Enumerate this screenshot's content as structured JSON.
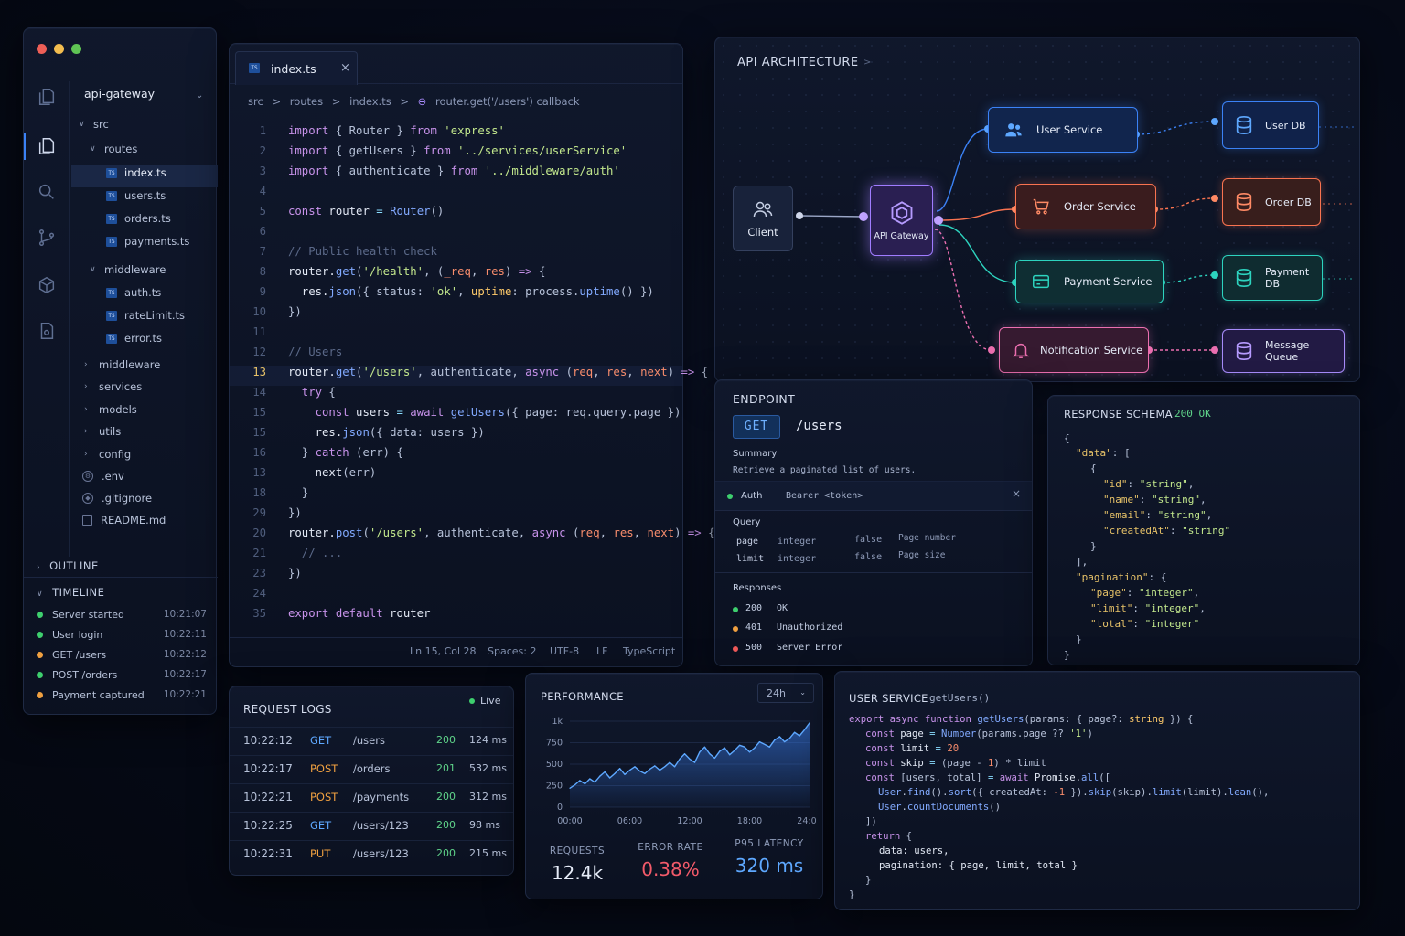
{
  "sidebar": {
    "project": "api-gateway",
    "tree": {
      "src": "src",
      "routes": "routes",
      "files_routes": [
        "index.ts",
        "users.ts",
        "orders.ts",
        "payments.ts"
      ],
      "middleware": "middleware",
      "files_middleware": [
        "auth.ts",
        "rateLimit.ts",
        "error.ts"
      ],
      "folders": [
        "middleware",
        "services",
        "models",
        "utils",
        "config"
      ],
      "env": ".env",
      "gitignore": ".gitignore",
      "readme": "README.md",
      "ts_badge": "TS"
    },
    "outline": "OUTLINE",
    "timeline": {
      "title": "TIMELINE",
      "items": [
        {
          "label": "Server started",
          "time": "10:21:07",
          "color": "#3ecf6e"
        },
        {
          "label": "User login",
          "time": "10:22:11",
          "color": "#3ecf6e"
        },
        {
          "label": "GET /users",
          "time": "10:22:12",
          "color": "#f0a040"
        },
        {
          "label": "POST /orders",
          "time": "10:22:17",
          "color": "#3ecf6e"
        },
        {
          "label": "Payment captured",
          "time": "10:22:21",
          "color": "#f0a040"
        }
      ]
    }
  },
  "editor": {
    "tab": "index.ts",
    "tab_close": "×",
    "breadcrumb": [
      "src",
      ">",
      "routes",
      ">",
      "index.ts",
      ">",
      "router.get('/users') callback"
    ],
    "status": {
      "pos": "Ln 15, Col 28",
      "spaces": "Spaces: 2",
      "enc": "UTF-8",
      "eol": "LF",
      "lang": "TypeScript"
    }
  },
  "arch": {
    "title": "API ARCHITECTURE",
    "chev": ">",
    "nodes": {
      "client": "Client",
      "gateway": "API Gateway",
      "user": "User Service",
      "order": "Order Service",
      "payment": "Payment Service",
      "notification": "Notification Service",
      "userdb": "User DB",
      "orderdb": "Order DB",
      "paymentdb": "Payment DB",
      "mq": "Message Queue"
    },
    "colors": {
      "blue": "#3b82f6",
      "orange": "#f97350",
      "teal": "#2dd4bf",
      "pink": "#ec6fb0",
      "purple": "#a78bfa"
    }
  },
  "endpoint": {
    "title": "ENDPOINT",
    "method": "GET",
    "path": "/users",
    "summary_label": "Summary",
    "summary": "Retrieve a paginated list of users.",
    "auth_label": "Auth",
    "auth_value": "Bearer <token>",
    "auth_close": "×",
    "query_label": "Query",
    "query": [
      {
        "name": "page",
        "type": "integer",
        "required": "false",
        "desc": "Page number"
      },
      {
        "name": "limit",
        "type": "integer",
        "required": "false",
        "desc": "Page size"
      }
    ],
    "responses_label": "Responses",
    "responses": [
      {
        "code": "200",
        "text": "OK",
        "color": "#3ecf6e"
      },
      {
        "code": "401",
        "text": "Unauthorized",
        "color": "#f0a040"
      },
      {
        "code": "500",
        "text": "Server Error",
        "color": "#f25a5a"
      }
    ]
  },
  "schema": {
    "title": "RESPONSE SCHEMA",
    "status": "200 OK"
  },
  "logs": {
    "title": "REQUEST LOGS",
    "live": "Live",
    "rows": [
      {
        "time": "10:22:12",
        "method": "GET",
        "path": "/users",
        "status": "200",
        "dur": "124 ms"
      },
      {
        "time": "10:22:17",
        "method": "POST",
        "path": "/orders",
        "status": "201",
        "dur": "532 ms"
      },
      {
        "time": "10:22:21",
        "method": "POST",
        "path": "/payments",
        "status": "200",
        "dur": "312 ms"
      },
      {
        "time": "10:22:25",
        "method": "GET",
        "path": "/users/123",
        "status": "200",
        "dur": "98 ms"
      },
      {
        "time": "10:22:31",
        "method": "PUT",
        "path": "/users/123",
        "status": "200",
        "dur": "215 ms"
      }
    ],
    "method_colors": {
      "GET": "#5ea8ff",
      "POST": "#f0a040",
      "PUT": "#f0a040"
    }
  },
  "perf": {
    "title": "PERFORMANCE",
    "range": "24h",
    "range_chev": "⌄",
    "metrics": [
      {
        "label": "REQUESTS",
        "value": "12.4k",
        "color": "#e6ecf8"
      },
      {
        "label": "ERROR RATE",
        "value": "0.38%",
        "color": "#f25a6a"
      },
      {
        "label": "P95 LATENCY",
        "value": "320 ms",
        "color": "#5ea8ff"
      }
    ]
  },
  "chart_data": {
    "type": "area",
    "title": "",
    "xlabel": "",
    "ylabel": "",
    "x_ticks": [
      "00:00",
      "06:00",
      "12:00",
      "18:00",
      "24:00"
    ],
    "y_ticks": [
      "0",
      "250",
      "500",
      "750",
      "1k"
    ],
    "ylim": [
      0,
      1000
    ],
    "xlim": [
      0,
      24
    ],
    "grid": true,
    "series": [
      {
        "x": [
          0,
          0.5,
          1,
          1.5,
          2,
          2.5,
          3,
          3.5,
          4,
          4.5,
          5,
          5.5,
          6,
          6.5,
          7,
          7.5,
          8,
          8.5,
          9,
          9.5,
          10,
          10.5,
          11,
          11.5,
          12,
          12.5,
          13,
          13.5,
          14,
          14.5,
          15,
          15.5,
          16,
          16.5,
          17,
          17.5,
          18,
          18.5,
          19,
          19.5,
          20,
          20.5,
          21,
          21.5,
          22,
          22.5,
          23,
          23.5,
          24
        ],
        "values": [
          220,
          260,
          310,
          270,
          330,
          290,
          360,
          410,
          340,
          390,
          450,
          380,
          430,
          470,
          420,
          390,
          440,
          480,
          430,
          470,
          520,
          470,
          560,
          620,
          560,
          520,
          640,
          700,
          620,
          570,
          650,
          690,
          610,
          660,
          720,
          700,
          640,
          690,
          760,
          730,
          700,
          780,
          820,
          760,
          800,
          870,
          830,
          900,
          980
        ]
      }
    ]
  },
  "usvc": {
    "title": "USER SERVICE",
    "fn": "getUsers()"
  }
}
